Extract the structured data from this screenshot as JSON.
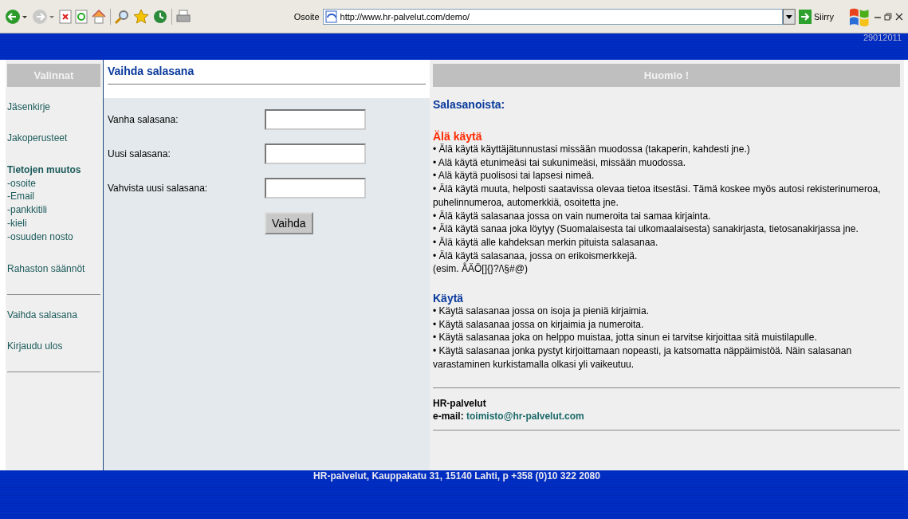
{
  "browser": {
    "address_label": "Osoite",
    "url": "http://www.hr-palvelut.com/demo/",
    "go_label": "Siirry"
  },
  "header": {
    "date": "29012011"
  },
  "sidebar": {
    "title": "Valinnat",
    "sections": [
      {
        "items": [
          {
            "label": "Jäsenkirje"
          },
          {
            "label": "Jakoperusteet"
          },
          {
            "label": "Tietojen muutos",
            "children": [
              {
                "label": "-osoite"
              },
              {
                "label": "-Email"
              },
              {
                "label": "-pankkitili"
              },
              {
                "label": "-kieli"
              },
              {
                "label": "-osuuden nosto"
              }
            ]
          },
          {
            "label": "Rahaston säännöt"
          }
        ]
      },
      {
        "items": [
          {
            "label": "Vaihda salasana"
          },
          {
            "label": "Kirjaudu ulos"
          }
        ]
      }
    ]
  },
  "form": {
    "title": "Vaihda salasana",
    "fields": [
      {
        "label": "Vanha salasana:"
      },
      {
        "label": "Uusi salasana:"
      },
      {
        "label": "Vahvista uusi salasana:"
      }
    ],
    "button": "Vaihda"
  },
  "notice": {
    "title": "Huomio !",
    "heading": "Salasanoista:",
    "sections": [
      {
        "kind": "warning",
        "title": "Älä käytä",
        "items": [
          "•  Älä käytä käyttäjätunnustasi missään muodossa (takaperin, kahdesti jne.)",
          "•  Alä käytä etunimeäsi tai sukunimeäsi, missään muodossa.",
          "•  Alä käytä puolisosi tai lapsesi nimeä.",
          "•  Älä käytä muuta, helposti saatavissa olevaa tietoa itsestäsi. Tämä koskee myös autosi rekisterinumeroa, puhelinnumeroa, automerkkiä, osoitetta jne.",
          "•  Älä käytä salasanaa jossa on vain numeroita tai samaa kirjainta.",
          "•  Älä käytä sanaa joka löytyy (Suomalaisesta tai ulkomaalaisesta) sanakirjasta, tietosanakirjassa jne.",
          "•  Älä käytä alle kahdeksan merkin pituista salasanaa.",
          "•  Älä käytä salasanaa, jossa on erikoismerkkejä."
        ],
        "note": "(esim. ÅÄÖ[]{}?/\\§#@)"
      },
      {
        "kind": "advice",
        "title": "Käytä",
        "items": [
          "•  Käytä salasanaa jossa on isoja ja pieniä kirjaimia.",
          "•  Käytä salasanaa jossa on kirjaimia ja numeroita.",
          "•  Käytä salasanaa joka on helppo muistaa, jotta sinun ei tarvitse kirjoittaa sitä muistilapulle.",
          "•  Käytä salasanaa jonka pystyt kirjoittamaan nopeasti, ja katsomatta näppäimistöä. Näin salasanan varastaminen kurkistamalla olkasi yli vaikeutuu."
        ]
      }
    ],
    "contact": {
      "company": "HR-palvelut",
      "email_label": "e-mail:",
      "email": "toimisto@hr-palvelut.com"
    }
  },
  "footer": {
    "text": "HR-palvelut, Kauppakatu 31, 15140 Lahti, p +358 (0)10 322 2080"
  }
}
